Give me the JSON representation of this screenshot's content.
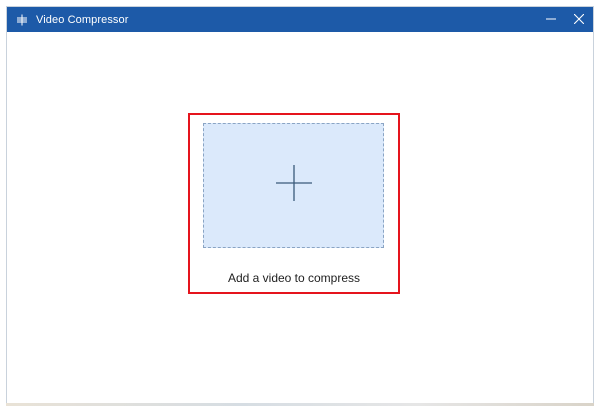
{
  "window": {
    "title": "Video Compressor",
    "titlebar_color": "#1d5aa8",
    "icons": {
      "app": "compress-icon",
      "minimize": "minimize-icon",
      "close": "close-icon"
    }
  },
  "main": {
    "drop_label": "Add a video to compress",
    "drop_icon": "plus-icon",
    "highlight_color": "#e5141d",
    "drop_zone_color": "#dbe9fb"
  }
}
